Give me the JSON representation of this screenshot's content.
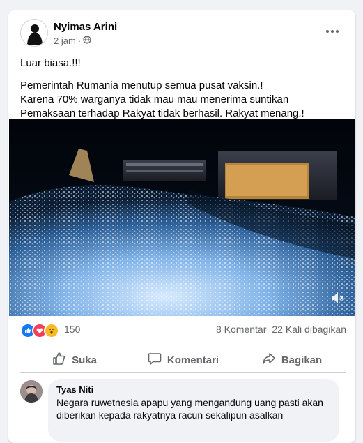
{
  "post": {
    "author": "Nyimas Arini",
    "time": "2 jam",
    "privacy_icon": "globe-icon",
    "text_lines": [
      "Luar biasa.!!!",
      "Pemerintah Rumania menutup semua pusat vaksin.!",
      "Karena 70% warganya tidak mau mau menerima suntikan",
      "Pemaksaan terhadap Rakyat tidak berhasil. Rakyat menang.!"
    ]
  },
  "stats": {
    "reaction_icons": [
      "like-icon",
      "love-icon",
      "wow-icon"
    ],
    "reaction_count": "150",
    "comments": "8 Komentar",
    "shares": "22 Kali dibagikan"
  },
  "actions": {
    "like": "Suka",
    "comment": "Komentari",
    "share": "Bagikan"
  },
  "comment": {
    "author": "Tyas Niti",
    "text": "Negara ruwetnesia apapu yang mengandung uang pasti akan diberikan kepada rakyatnya racun sekalipun asalkan"
  },
  "colors": {
    "accent": "#1877f2",
    "love": "#f33e58",
    "wow": "#f7b928",
    "text_secondary": "#65676b"
  }
}
